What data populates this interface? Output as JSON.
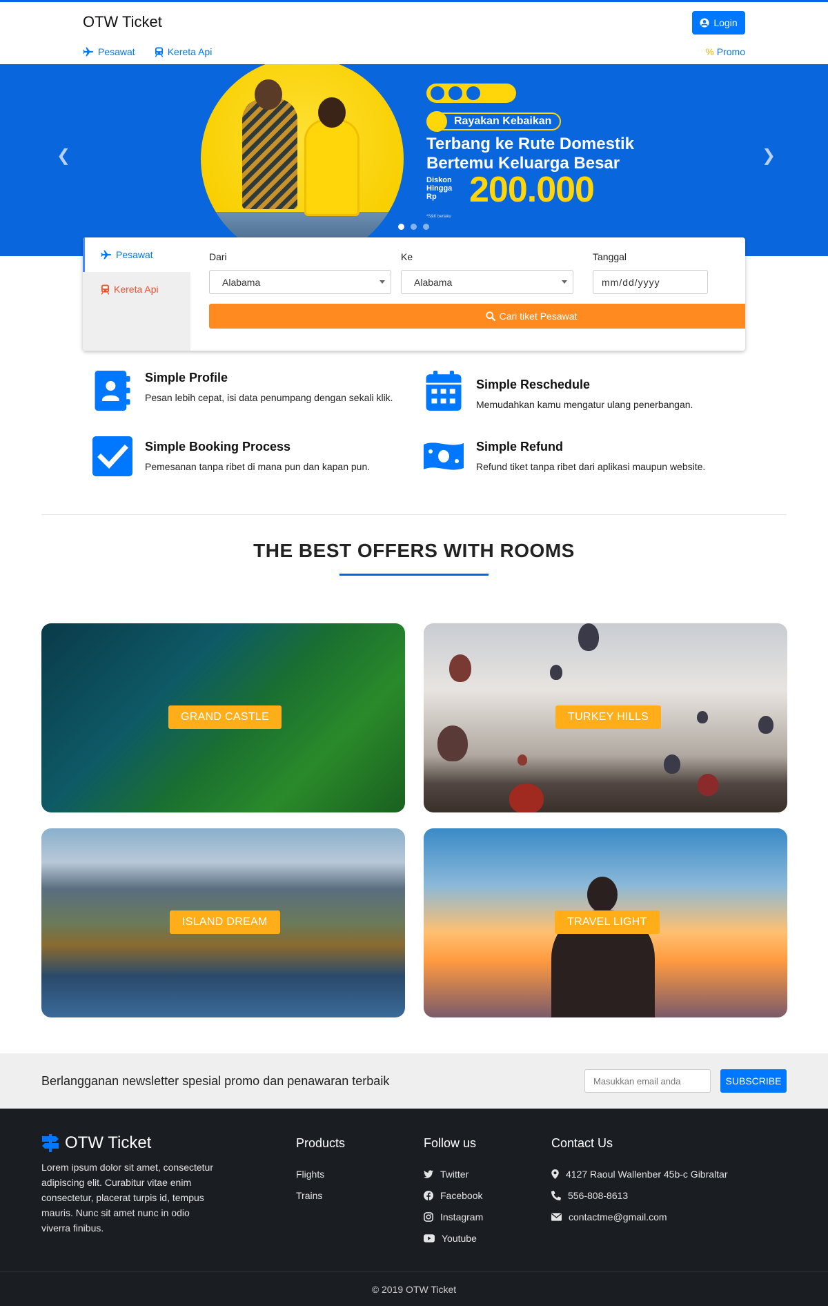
{
  "header": {
    "brand": "OTW Ticket",
    "login_label": "Login",
    "nav": [
      {
        "label": "Pesawat",
        "icon": "plane-icon"
      },
      {
        "label": "Kereta Api",
        "icon": "train-icon"
      }
    ],
    "promo_symbol": "%",
    "promo_label": "Promo"
  },
  "hero": {
    "ribbon": "Rayakan Kebaikan",
    "title_line1": "Terbang ke Rute Domestik",
    "title_line2": "Bertemu Keluarga Besar",
    "disc_line1": "Diskon",
    "disc_line2": "Hingga",
    "disc_line3": "Rp",
    "amount": "200.000",
    "fineprint": "*S&K berlaku",
    "slides": 3,
    "active_slide": 1,
    "accent": "#ffd60a",
    "background": "#0a66dd"
  },
  "search": {
    "tabs": [
      {
        "label": "Pesawat",
        "icon": "plane-icon",
        "active": true
      },
      {
        "label": "Kereta Api",
        "icon": "train-icon",
        "active": false
      }
    ],
    "from_label": "Dari",
    "from_value": "Alabama",
    "to_label": "Ke",
    "to_value": "Alabama",
    "date_label": "Tanggal",
    "date_placeholder": "mm/dd/yyyy",
    "button_label": "Cari tiket Pesawat",
    "button_color": "#ff8a1f"
  },
  "features": [
    {
      "title": "Simple Profile",
      "desc": "Pesan lebih cepat, isi data penumpang dengan sekali klik.",
      "icon": "address-book-icon"
    },
    {
      "title": "Simple Reschedule",
      "desc": "Memudahkan kamu mengatur ulang penerbangan.",
      "icon": "calendar-icon"
    },
    {
      "title": "Simple Booking Process",
      "desc": "Pemesanan tanpa ribet di mana pun dan kapan pun.",
      "icon": "check-square-icon"
    },
    {
      "title": "Simple Refund",
      "desc": "Refund tiket tanpa ribet dari aplikasi maupun website.",
      "icon": "money-bill-icon"
    }
  ],
  "offers": {
    "title": "THE BEST OFFERS WITH ROOMS",
    "items": [
      {
        "label": "GRAND CASTLE"
      },
      {
        "label": "TURKEY HILLS"
      },
      {
        "label": "ISLAND DREAM"
      },
      {
        "label": "TRAVEL LIGHT"
      }
    ],
    "label_color": "#ffae1a"
  },
  "newsletter": {
    "text": "Berlangganan newsletter spesial promo dan penawaran terbaik",
    "placeholder": "Masukkan email anda",
    "button_label": "SUBSCRIBE"
  },
  "footer": {
    "brand": "OTW Ticket",
    "about": "Lorem ipsum dolor sit amet, consectetur adipiscing elit. Curabitur vitae enim consectetur, placerat turpis id, tempus mauris. Nunc sit amet nunc in odio viverra finibus.",
    "products_title": "Products",
    "products": [
      "Flights",
      "Trains"
    ],
    "follow_title": "Follow us",
    "follow": [
      {
        "label": "Twitter",
        "icon": "twitter-icon"
      },
      {
        "label": "Facebook",
        "icon": "facebook-icon"
      },
      {
        "label": "Instagram",
        "icon": "instagram-icon"
      },
      {
        "label": "Youtube",
        "icon": "youtube-icon"
      }
    ],
    "contact_title": "Contact Us",
    "contact": [
      {
        "label": "4127 Raoul Wallenber 45b-c Gibraltar",
        "icon": "map-marker-icon"
      },
      {
        "label": "556-808-8613",
        "icon": "phone-icon"
      },
      {
        "label": "contactme@gmail.com",
        "icon": "envelope-icon"
      }
    ],
    "copyright": "© 2019 OTW Ticket"
  }
}
